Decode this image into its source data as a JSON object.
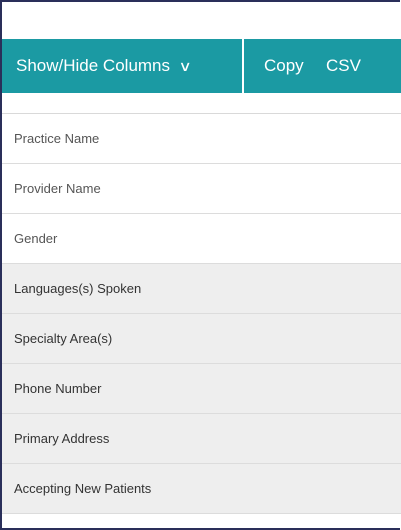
{
  "toolbar": {
    "show_hide_label": "Show/Hide Columns",
    "chevron": "∨",
    "copy_label": "Copy",
    "csv_label": "CSV"
  },
  "columns": [
    {
      "label": "Practice Name",
      "visible": false
    },
    {
      "label": "Provider Name",
      "visible": false
    },
    {
      "label": "Gender",
      "visible": false
    },
    {
      "label": "Languages(s) Spoken",
      "visible": true
    },
    {
      "label": "Specialty Area(s)",
      "visible": true
    },
    {
      "label": "Phone Number",
      "visible": true
    },
    {
      "label": "Primary Address",
      "visible": true
    },
    {
      "label": "Accepting New Patients",
      "visible": true
    }
  ],
  "colors": {
    "toolbar_bg": "#1b9aa3",
    "selected_row_bg": "#eeeeee",
    "frame_border": "#2a2f5a"
  }
}
